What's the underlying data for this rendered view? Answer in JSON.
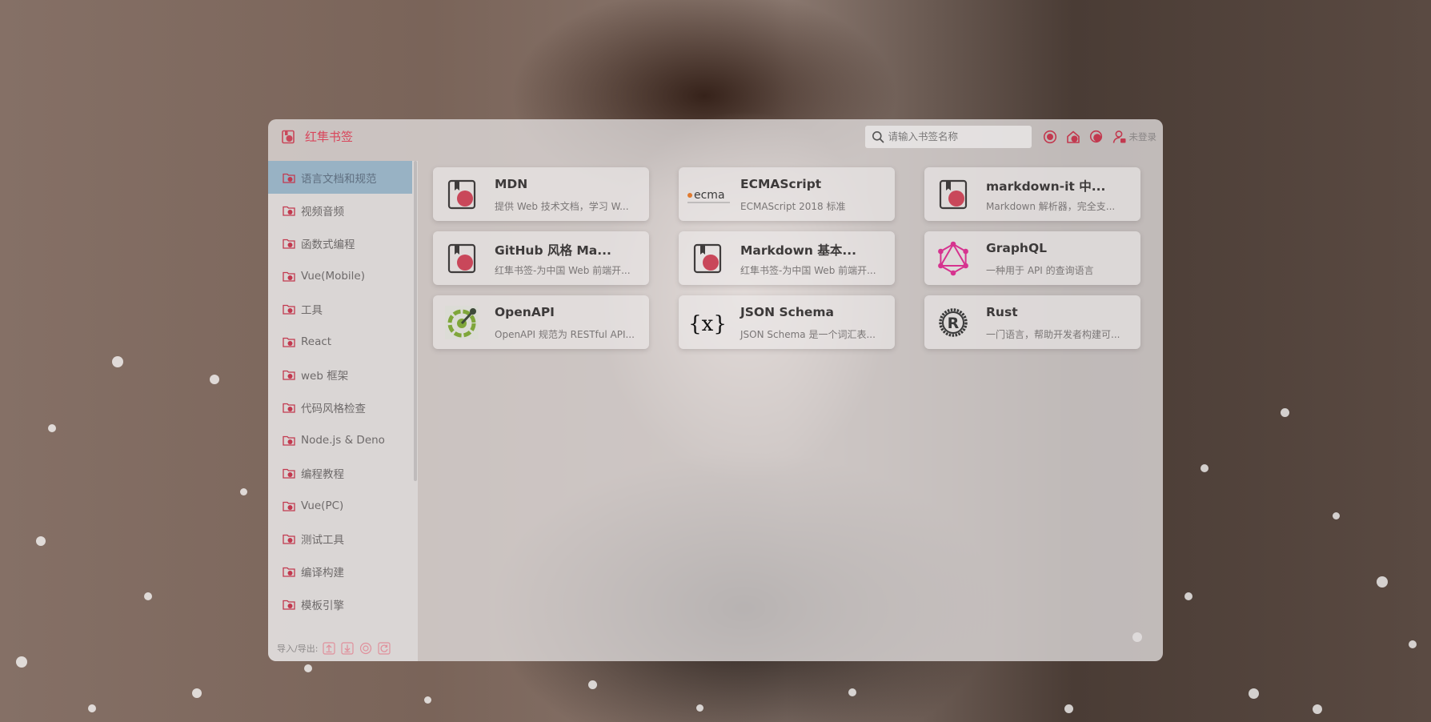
{
  "app": {
    "title": "红隼书签"
  },
  "header": {
    "search_placeholder": "请输入书签名称",
    "login_label": "未登录",
    "icons": [
      "record-icon",
      "home-icon",
      "target-icon",
      "user-lock-icon"
    ]
  },
  "sidebar": {
    "items": [
      {
        "label": "语言文档和规范",
        "active": true
      },
      {
        "label": "视频音频"
      },
      {
        "label": "函数式编程"
      },
      {
        "label": "Vue(Mobile)"
      },
      {
        "label": "工具"
      },
      {
        "label": "React"
      },
      {
        "label": "web 框架"
      },
      {
        "label": "代码风格检查"
      },
      {
        "label": "Node.js & Deno"
      },
      {
        "label": "编程教程"
      },
      {
        "label": "Vue(PC)"
      },
      {
        "label": "测试工具"
      },
      {
        "label": "编译构建"
      },
      {
        "label": "模板引擎"
      }
    ],
    "footer": {
      "label": "导入/导出:",
      "icons": [
        "upload-icon",
        "download-icon",
        "sync-icon",
        "refresh-icon"
      ]
    }
  },
  "bookmarks": [
    {
      "title": "MDN",
      "desc": "提供 Web 技术文档，学习 W...",
      "icon": "bookmark-icon"
    },
    {
      "title": "ECMAScript",
      "desc": "ECMAScript 2018 标准",
      "icon": "ecma-logo",
      "logo_text": "ecma"
    },
    {
      "title": "markdown-it 中...",
      "desc": "Markdown 解析器，完全支...",
      "icon": "bookmark-icon"
    },
    {
      "title": "GitHub 风格 Ma...",
      "desc": "红隼书签-为中国 Web 前端开...",
      "icon": "bookmark-icon"
    },
    {
      "title": "Markdown 基本...",
      "desc": "红隼书签-为中国 Web 前端开...",
      "icon": "bookmark-icon"
    },
    {
      "title": "GraphQL",
      "desc": "一种用于 API 的查询语言",
      "icon": "graphql-logo"
    },
    {
      "title": "OpenAPI",
      "desc": "OpenAPI 规范为 RESTful API...",
      "icon": "openapi-logo"
    },
    {
      "title": "JSON Schema",
      "desc": "JSON Schema 是一个词汇表...",
      "icon": "json-schema-logo",
      "logo_text": "{x}"
    },
    {
      "title": "Rust",
      "desc": "一门语言，帮助开发者构建可...",
      "icon": "rust-logo",
      "logo_text": "R"
    }
  ],
  "colors": {
    "accent": "#d9455b",
    "active_item": "#82a5be"
  }
}
